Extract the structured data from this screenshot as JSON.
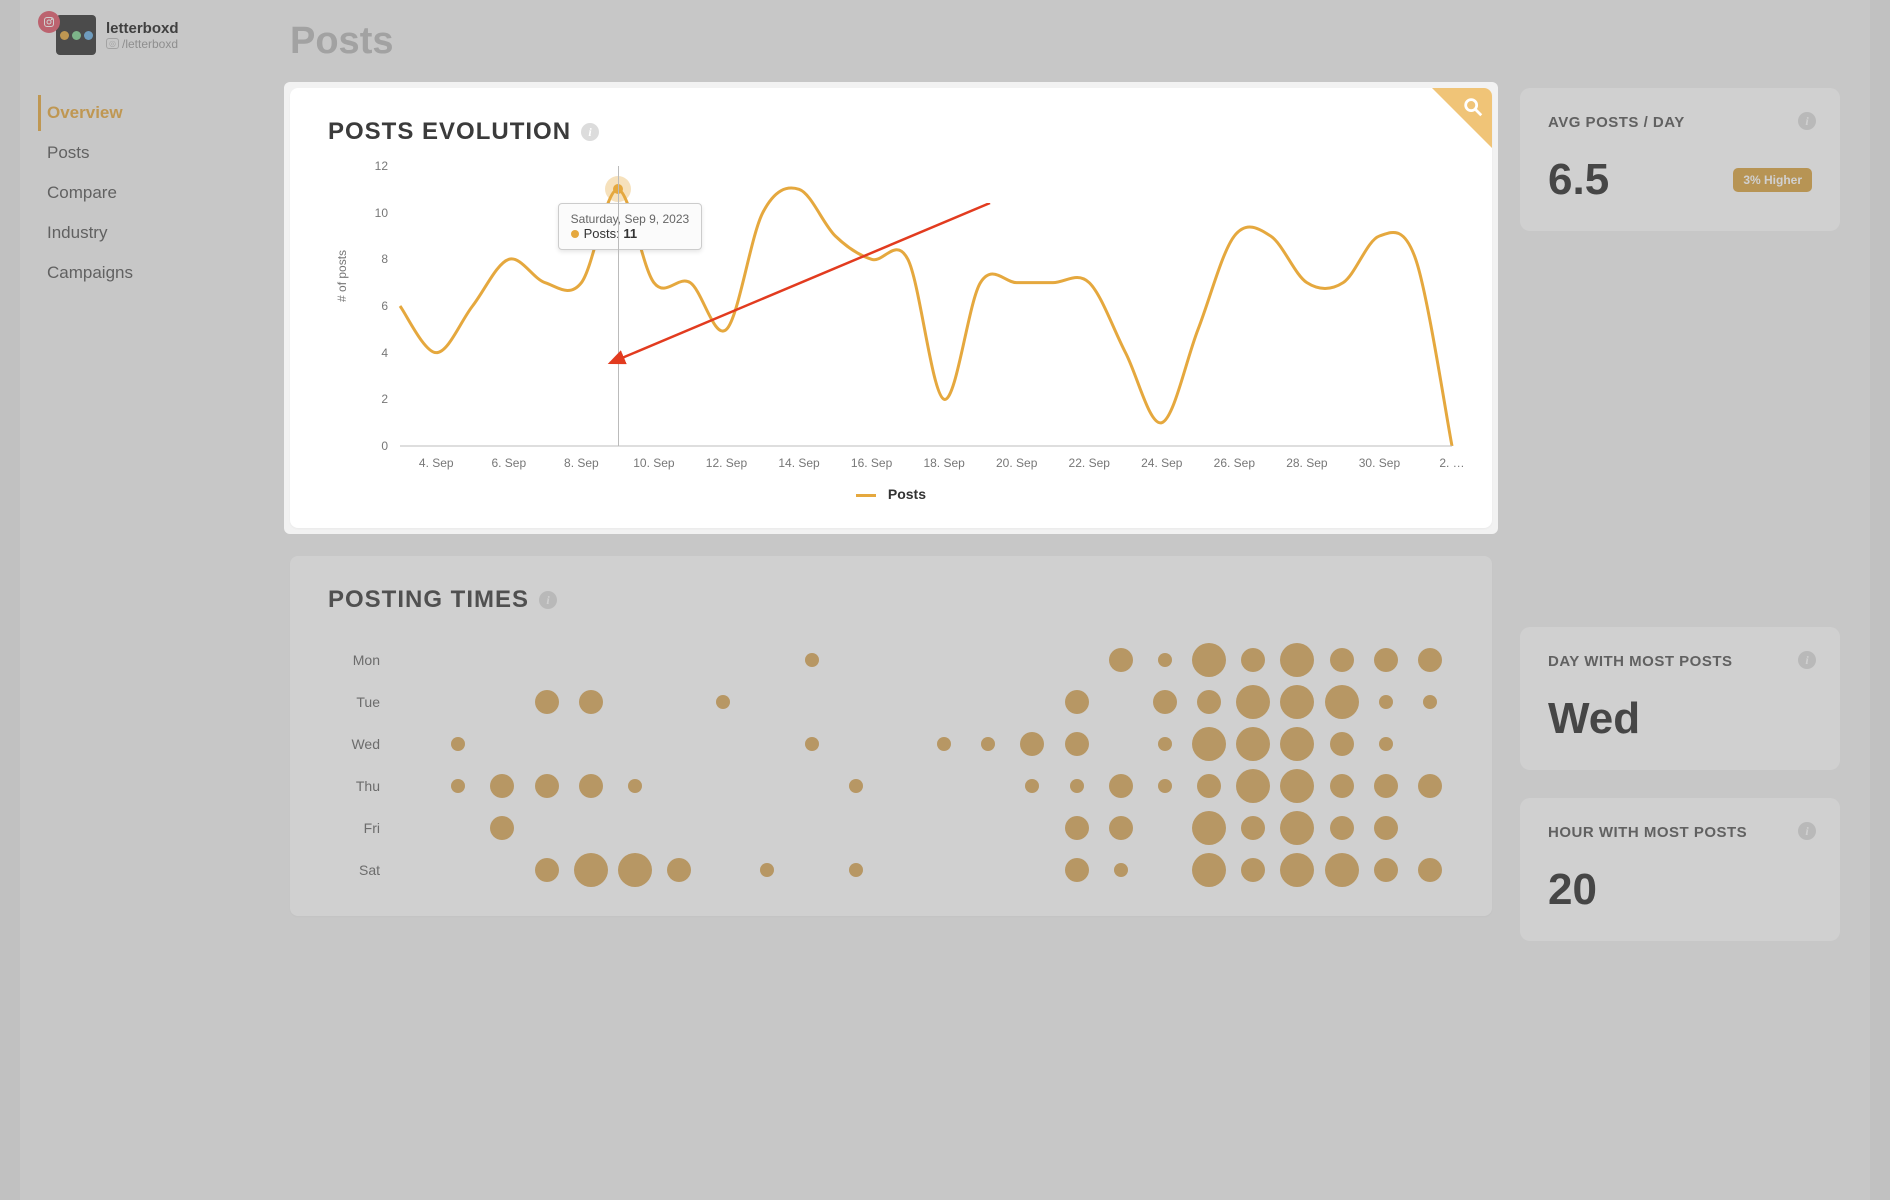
{
  "profile": {
    "name": "letterboxd",
    "handle": "/letterboxd",
    "platform_icon": "instagram"
  },
  "nav": {
    "items": [
      "Overview",
      "Posts",
      "Compare",
      "Industry",
      "Campaigns"
    ],
    "active": 0
  },
  "page_title": "Posts",
  "chart_panel": {
    "title": "POSTS EVOLUTION",
    "legend": "Posts",
    "yaxis": "# of posts",
    "tooltip": {
      "date": "Saturday, Sep 9, 2023",
      "label": "Posts",
      "value": "11"
    }
  },
  "posting_panel": {
    "title": "POSTING TIMES",
    "days": [
      "Mon",
      "Tue",
      "Wed",
      "Thu",
      "Fri",
      "Sat"
    ]
  },
  "cards": {
    "avg": {
      "label": "AVG POSTS / DAY",
      "value": "6.5",
      "badge": "3% Higher"
    },
    "day": {
      "label": "DAY WITH MOST POSTS",
      "value": "Wed"
    },
    "hour": {
      "label": "HOUR WITH MOST POSTS",
      "value": "20"
    }
  },
  "chart_data": {
    "type": "line",
    "title": "POSTS EVOLUTION",
    "ylabel": "# of posts",
    "xlabel": "",
    "ylim": [
      0,
      12
    ],
    "y_ticks": [
      0,
      2,
      4,
      6,
      8,
      10,
      12
    ],
    "x_labels": [
      "4. Sep",
      "6. Sep",
      "8. Sep",
      "10. Sep",
      "12. Sep",
      "14. Sep",
      "16. Sep",
      "18. Sep",
      "20. Sep",
      "22. Sep",
      "24. Sep",
      "26. Sep",
      "28. Sep",
      "30. Sep",
      "2. …"
    ],
    "series": [
      {
        "name": "Posts",
        "x": [
          "3. Sep",
          "4. Sep",
          "5. Sep",
          "6. Sep",
          "7. Sep",
          "8. Sep",
          "9. Sep",
          "10. Sep",
          "11. Sep",
          "12. Sep",
          "13. Sep",
          "14. Sep",
          "15. Sep",
          "16. Sep",
          "17. Sep",
          "18. Sep",
          "19. Sep",
          "20. Sep",
          "21. Sep",
          "22. Sep",
          "23. Sep",
          "24. Sep",
          "25. Sep",
          "26. Sep",
          "27. Sep",
          "28. Sep",
          "29. Sep",
          "30. Sep",
          "1. Oct",
          "2. Oct"
        ],
        "values": [
          6,
          4,
          6,
          8,
          7,
          7,
          11,
          7,
          7,
          5,
          10,
          11,
          9,
          8,
          8,
          2,
          7,
          7,
          7,
          7,
          4,
          1,
          5,
          9,
          9,
          7,
          7,
          9,
          8,
          0
        ]
      }
    ],
    "highlight": {
      "x": "9. Sep",
      "value": 11
    }
  },
  "posting_times_data": {
    "type": "heatmap",
    "rows": [
      "Mon",
      "Tue",
      "Wed",
      "Thu",
      "Fri",
      "Sat"
    ],
    "cols_range": [
      0,
      23
    ],
    "bubbles": {
      "Mon": [
        [
          9,
          1
        ],
        [
          16,
          2
        ],
        [
          17,
          1
        ],
        [
          18,
          3
        ],
        [
          19,
          2
        ],
        [
          20,
          3
        ],
        [
          21,
          2
        ],
        [
          22,
          2
        ],
        [
          23,
          2
        ]
      ],
      "Tue": [
        [
          3,
          2
        ],
        [
          4,
          2
        ],
        [
          7,
          1
        ],
        [
          15,
          2
        ],
        [
          17,
          2
        ],
        [
          18,
          2
        ],
        [
          19,
          3
        ],
        [
          20,
          3
        ],
        [
          21,
          3
        ],
        [
          22,
          1
        ],
        [
          23,
          1
        ]
      ],
      "Wed": [
        [
          1,
          1
        ],
        [
          9,
          1
        ],
        [
          12,
          1
        ],
        [
          13,
          1
        ],
        [
          14,
          2
        ],
        [
          15,
          2
        ],
        [
          17,
          1
        ],
        [
          18,
          3
        ],
        [
          19,
          3
        ],
        [
          20,
          3
        ],
        [
          21,
          2
        ],
        [
          22,
          1
        ]
      ],
      "Thu": [
        [
          1,
          1
        ],
        [
          2,
          2
        ],
        [
          3,
          2
        ],
        [
          4,
          2
        ],
        [
          5,
          1
        ],
        [
          10,
          1
        ],
        [
          14,
          1
        ],
        [
          15,
          1
        ],
        [
          16,
          2
        ],
        [
          17,
          1
        ],
        [
          18,
          2
        ],
        [
          19,
          3
        ],
        [
          20,
          3
        ],
        [
          21,
          2
        ],
        [
          22,
          2
        ],
        [
          23,
          2
        ]
      ],
      "Fri": [
        [
          2,
          2
        ],
        [
          15,
          2
        ],
        [
          16,
          2
        ],
        [
          18,
          3
        ],
        [
          19,
          2
        ],
        [
          20,
          3
        ],
        [
          21,
          2
        ],
        [
          22,
          2
        ]
      ],
      "Sat": [
        [
          3,
          2
        ],
        [
          4,
          3
        ],
        [
          5,
          3
        ],
        [
          6,
          2
        ],
        [
          8,
          1
        ],
        [
          10,
          1
        ],
        [
          15,
          2
        ],
        [
          16,
          1
        ],
        [
          18,
          3
        ],
        [
          19,
          2
        ],
        [
          20,
          3
        ],
        [
          21,
          3
        ],
        [
          22,
          2
        ],
        [
          23,
          2
        ]
      ]
    }
  }
}
